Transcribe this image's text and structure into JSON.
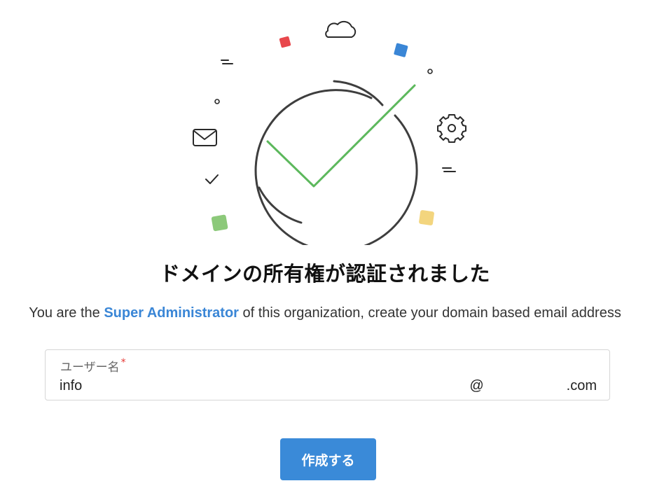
{
  "page": {
    "title": "ドメインの所有権が認証されました",
    "subtitle_before": "You are the ",
    "subtitle_role": "Super Administrator",
    "subtitle_after": " of this organization, create your domain based email address"
  },
  "form": {
    "username_label": "ユーザー名",
    "required_mark": "*",
    "username_value": "info",
    "domain_at": "@",
    "domain_tld": ".com"
  },
  "actions": {
    "create_label": "作成する"
  },
  "illustration": {
    "icons": [
      "cloud-icon",
      "envelope-icon",
      "gear-icon",
      "check-small-icon",
      "big-checkmark-icon"
    ],
    "accent_colors": {
      "check": "#5cb85c",
      "red": "#e8474c",
      "blue": "#3a86d6",
      "green": "#8cc97a",
      "yellow": "#f3d57e"
    }
  },
  "colors": {
    "primary": "#3a8ad8",
    "required": "#e53935"
  }
}
